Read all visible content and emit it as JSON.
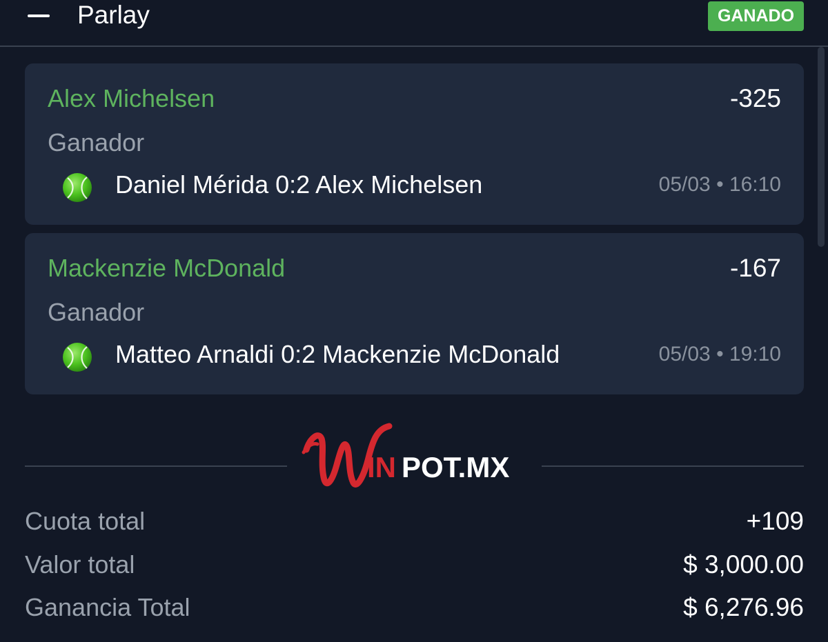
{
  "header": {
    "title": "Parlay",
    "status": "GANADO"
  },
  "bets": [
    {
      "selection": "Alex Michelsen",
      "odds": "-325",
      "market": "Ganador",
      "sport_icon": "tennis-ball-icon",
      "match": "Daniel Mérida 0:2 Alex Michelsen",
      "time": "05/03 • 16:10"
    },
    {
      "selection": "Mackenzie McDonald",
      "odds": "-167",
      "market": "Ganador",
      "sport_icon": "tennis-ball-icon",
      "match": "Matteo Arnaldi 0:2 Mackenzie McDonald",
      "time": "05/03 • 19:10"
    }
  ],
  "logo": {
    "text": "WINPOT.MX"
  },
  "summary": {
    "odds_label": "Cuota total",
    "odds_value": "+109",
    "stake_label": "Valor total",
    "stake_value": "$ 3,000.00",
    "payout_label": "Ganancia Total",
    "payout_value": "$ 6,276.96"
  },
  "colors": {
    "background": "#121826",
    "card": "#202a3d",
    "win_green": "#4caf50",
    "selection_green": "#5eb35e",
    "brand_red": "#d4282f"
  }
}
